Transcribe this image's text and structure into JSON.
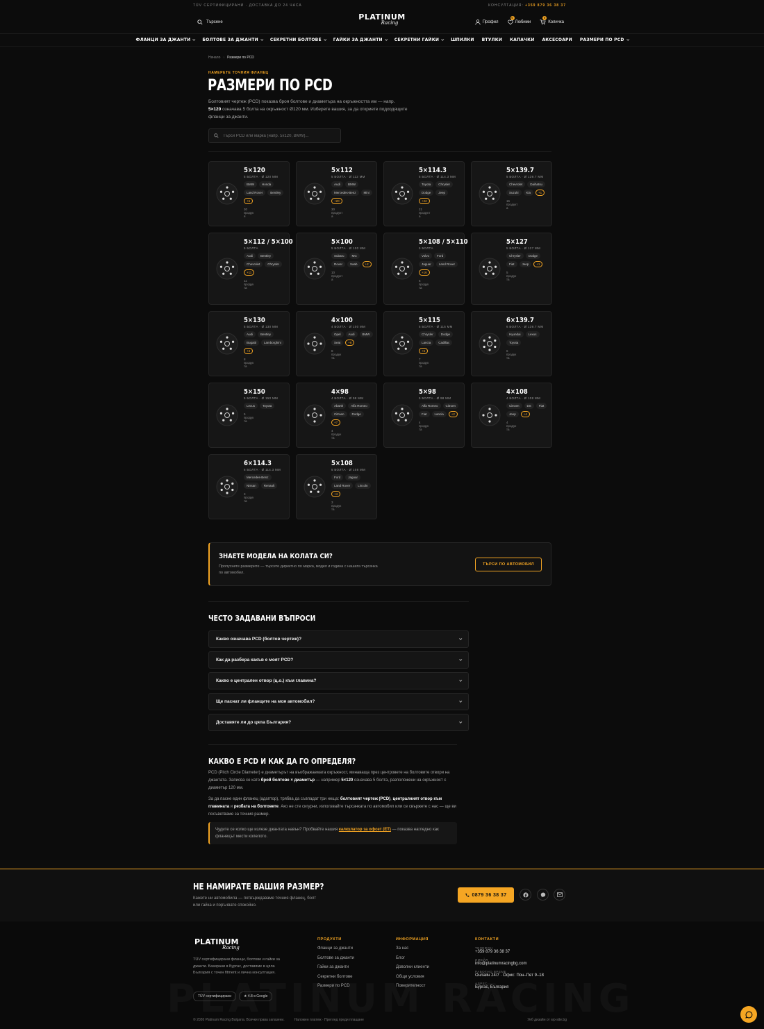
{
  "topbar": {
    "left": "TÜV СЕРТИФИЦИРАНИ · ДОСТАВКА ДО 24 ЧАСА",
    "consult_label": "КОНСУЛТАЦИЯ:",
    "phone": "+359 879 36 38 37"
  },
  "header": {
    "search": "Търсене",
    "logo_main": "PLATINUM",
    "logo_sub": "Racing",
    "profile": "Профил",
    "favorites": "Любими",
    "favorites_count": "0",
    "cart": "Количка",
    "cart_count": "0"
  },
  "nav": [
    {
      "label": "ФЛАНЦИ ЗА ДЖАНТИ",
      "dropdown": true
    },
    {
      "label": "БОЛТОВЕ ЗА ДЖАНТИ",
      "dropdown": true
    },
    {
      "label": "СЕКРЕТНИ БОЛТОВЕ",
      "dropdown": true
    },
    {
      "label": "ГАЙКИ ЗА ДЖАНТИ",
      "dropdown": true
    },
    {
      "label": "СЕКРЕТНИ ГАЙКИ",
      "dropdown": true
    },
    {
      "label": "ШПИЛКИ",
      "dropdown": false
    },
    {
      "label": "ВТУЛКИ",
      "dropdown": false
    },
    {
      "label": "КАПАЧКИ",
      "dropdown": false
    },
    {
      "label": "АКСЕСОАРИ",
      "dropdown": false
    },
    {
      "label": "РАЗМЕРИ ПО PCD",
      "dropdown": true
    }
  ],
  "breadcrumb": {
    "home": "Начало",
    "current": "Размери по PCD"
  },
  "hero": {
    "eyebrow": "НАМЕРЕТЕ ТОЧНИЯ ФЛАНЕЦ",
    "title": "РАЗМЕРИ ПО PCD",
    "intro_1": "Болтовият чертеж (PCD) показва броя болтове и диаметъра на окръжността им — напр.",
    "intro_bold": "5×120",
    "intro_2": " означава 5 болта на окръжност Ø120 мм. Изберете вашия, за да откриете подходящите фланци за джанти.",
    "search_placeholder": "Търси PCD или марка (напр. 5x120, BMW)..."
  },
  "cards": [
    {
      "pcd": "5×120",
      "sub": "5 БОЛТА · Ø 120 ММ",
      "bolts": 5,
      "chips": [
        "BMW",
        "Honda",
        "Land Rover",
        "Bentley"
      ],
      "more": "+6",
      "count": "30",
      "unit": "продук",
      "suffix": "я"
    },
    {
      "pcd": "5×112",
      "sub": "5 БОЛТА · Ø 112 ММ",
      "bolts": 5,
      "chips": [
        "Audi",
        "BMW",
        "Mercedes-Benz",
        "Mini"
      ],
      "more": "+20",
      "count": "30",
      "unit": "продукт",
      "suffix": "а"
    },
    {
      "pcd": "5×114.3",
      "sub": "5 БОЛТА · Ø 114.3 ММ",
      "bolts": 5,
      "chips": [
        "Toyota",
        "Chrysler",
        "Dodge",
        "Jeep"
      ],
      "more": "+22",
      "count": "21",
      "unit": "продукт",
      "suffix": "а"
    },
    {
      "pcd": "5×139.7",
      "sub": "5 БОЛТА · Ø 139.7 ММ",
      "bolts": 5,
      "chips": [
        "Chevrolet",
        "Daihatsu",
        "Suzuki",
        "Kia"
      ],
      "more": "+1",
      "count": "15",
      "unit": "продукт",
      "suffix": "а"
    },
    {
      "pcd": "5×112 / 5×100",
      "sub": "5 БОЛТА",
      "bolts": 5,
      "chips": [
        "Audi",
        "Bentley",
        "Chevrolet",
        "Chrysler"
      ],
      "more": "+11",
      "count": "11",
      "unit": "продук",
      "suffix": "та"
    },
    {
      "pcd": "5×100",
      "sub": "5 БОЛТА · Ø 100 ММ",
      "bolts": 5,
      "chips": [
        "Subaru",
        "MG",
        "Rover",
        "Saab"
      ],
      "more": "+2",
      "count": "10",
      "unit": "продукт",
      "suffix": "а"
    },
    {
      "pcd": "5×108 / 5×110",
      "sub": "5 БОЛТА",
      "bolts": 5,
      "chips": [
        "Volvo",
        "Ford",
        "Jaguar",
        "Land Rover"
      ],
      "more": "+16",
      "count": "6",
      "unit": "продук",
      "suffix": "та"
    },
    {
      "pcd": "5×127",
      "sub": "5 БОЛТА · Ø 127 ММ",
      "bolts": 5,
      "chips": [
        "Chrysler",
        "Dodge",
        "Fiat",
        "Jeep"
      ],
      "more": "+1",
      "count": "5",
      "unit": "продук",
      "suffix": "та"
    },
    {
      "pcd": "5×130",
      "sub": "5 БОЛТА · Ø 130 ММ",
      "bolts": 5,
      "chips": [
        "Audi",
        "Bentley",
        "Bugatti",
        "Lamborghini"
      ],
      "more": "+3",
      "count": "8",
      "unit": "продук",
      "suffix": "та"
    },
    {
      "pcd": "4×100",
      "sub": "4 БОЛТА · Ø 100 ММ",
      "bolts": 4,
      "chips": [
        "Opel",
        "Audi",
        "BMW",
        "Seat"
      ],
      "more": "+8",
      "count": "8",
      "unit": "продук",
      "suffix": "та"
    },
    {
      "pcd": "5×115",
      "sub": "5 БОЛТА · Ø 115 ММ",
      "bolts": 5,
      "chips": [
        "Chrysler",
        "Dodge",
        "Lancia",
        "Cadillac"
      ],
      "more": "+5",
      "count": "7",
      "unit": "продук",
      "suffix": "та"
    },
    {
      "pcd": "6×139.7",
      "sub": "6 БОЛТА · Ø 139.7 ММ",
      "bolts": 6,
      "chips": [
        "Hyundai",
        "Lexus",
        "Toyota"
      ],
      "more": "",
      "count": "6",
      "unit": "продук",
      "suffix": "та"
    },
    {
      "pcd": "5×150",
      "sub": "5 БОЛТА · Ø 150 ММ",
      "bolts": 5,
      "chips": [
        "Lexus",
        "Toyota"
      ],
      "more": "",
      "count": "5",
      "unit": "продук",
      "suffix": "та"
    },
    {
      "pcd": "4×98",
      "sub": "4 БОЛТА · Ø 98 ММ",
      "bolts": 4,
      "chips": [
        "Abarth",
        "Alfa Romeo",
        "Citroen",
        "Dodge"
      ],
      "more": "+7",
      "count": "4",
      "unit": "продук",
      "suffix": "та"
    },
    {
      "pcd": "5×98",
      "sub": "5 БОЛТА · Ø 98 ММ",
      "bolts": 5,
      "chips": [
        "Alfa Romeo",
        "Citroen",
        "Fiat",
        "Lancia"
      ],
      "more": "+2",
      "count": "4",
      "unit": "продук",
      "suffix": "та"
    },
    {
      "pcd": "4×108",
      "sub": "4 БОЛТА · Ø 108 ММ",
      "bolts": 4,
      "chips": [
        "Citroen",
        "DS",
        "Fiat",
        "Jeep"
      ],
      "more": "+4",
      "count": "4",
      "unit": "продук",
      "suffix": "та"
    },
    {
      "pcd": "6×114.3",
      "sub": "6 БОЛТА · Ø 114.3 ММ",
      "bolts": 6,
      "chips": [
        "Mercedes-Benz",
        "Nissan",
        "Renault"
      ],
      "more": "",
      "count": "3",
      "unit": "продук",
      "suffix": "та"
    },
    {
      "pcd": "5×108",
      "sub": "5 БОЛТА · Ø 108 ММ",
      "bolts": 5,
      "chips": [
        "Ford",
        "Jaguar",
        "Land Rover",
        "Lincoln"
      ],
      "more": "+4",
      "count": "3",
      "unit": "продук",
      "suffix": "та"
    }
  ],
  "cta": {
    "title": "ЗНАЕТЕ МОДЕЛА НА КОЛАТА СИ?",
    "text": "Пропуснете размерите — търсете директно по марка, модел и година с нашата търсачка по автомобил.",
    "button": "ТЪРСИ ПО АВТОМОБИЛ"
  },
  "faq": {
    "title": "ЧЕСТО ЗАДАВАНИ ВЪПРОСИ",
    "items": [
      "Какво означава PCD (болтов чертеж)?",
      "Как да разбера какъв е моят PCD?",
      "Какво е централен отвор (ц.о.) към главина?",
      "Ще паснат ли фланците на моя автомобил?",
      "Доставяте ли до цяла България?"
    ]
  },
  "about": {
    "title": "КАКВО Е PCD И КАК ДА ГО ОПРЕДЕЛЯ?",
    "p1a": "PCD (Pitch Circle Diameter) е диаметърът на въображаемата окръжност, минаваща през центровете на болтовите отвори на джантата. Записва се като ",
    "p1b": "брой болтове × диаметър",
    "p1c": " — например ",
    "p1d": "5×120",
    "p1e": " означава 5 болта, разположени на окръжност с диаметър 120 мм.",
    "p2a": "За да пасне един фланец (адаптор), трябва да съвпадат три неща: ",
    "p2b": "болтовият чертеж (PCD)",
    "p2c": ", ",
    "p2d": "централният отвор към главината",
    "p2e": " и ",
    "p2f": "резбата на болтовете",
    "p2g": ". Ако не сте сигурни, използвайте търсачката по автомобил или се свържете с нас — ще ви посъветваме за точния размер.",
    "note_a": "Чудите се колко ще излезе джантата навън? Пробвайте нашия ",
    "note_link": "калкулатор за офсет (ET)",
    "note_b": " — показва нагледно как фланецът мести колелото."
  },
  "band": {
    "title": "НЕ НАМИРАТЕ ВАШИЯ РАЗМЕР?",
    "text": "Кажете ни автомобила — потвърждаваме точния фланец, болт или гайка и поръчвате спокойно.",
    "phone": "0879 36 38 37"
  },
  "footer": {
    "logo_main": "PLATINUM",
    "logo_sub": "Racing",
    "desc": "TÜV сертифицирани фланци, болтове и гайки за джанти. Базирани в Бургас, доставяме в цяла България с точен fitment и лична консултация.",
    "badge1": "TÜV сертифицирани",
    "badge2": "★ 4.8 в Google",
    "watermark": "PLATINUM RACING",
    "products_title": "ПРОДУКТИ",
    "products": [
      "Фланци за джанти",
      "Болтове за джанти",
      "Гайки за джанти",
      "Секретни болтове",
      "Размери по PCD"
    ],
    "info_title": "ИНФОРМАЦИЯ",
    "info": [
      "За нас",
      "Блог",
      "Доволни клиенти",
      "Общи условия",
      "Поверителност"
    ],
    "contacts_title": "КОНТАКТИ",
    "phone_label": "ТЕЛЕФОН",
    "phone": "+359 879 36 38 37",
    "email_label": "ИМЕЙЛ",
    "email": "info@platinumracingbg.com",
    "hours_label": "РАБОТНО ВРЕМЕ",
    "hours": "Онлайн 24/7 · Офис: Пон–Пет 9–18",
    "address_label": "АДРЕС",
    "address": "Бургас, България",
    "copyright": "© 2026 Platinum Racing Bulgaria. Всички права запазени.",
    "payment": "Наложен платеж · Преглед преди плащане",
    "credit": "Уеб дизайн от wp-site.bg"
  },
  "colors": {
    "accent": "#f5a623",
    "bg": "#0c0c0c",
    "card": "#161616"
  }
}
